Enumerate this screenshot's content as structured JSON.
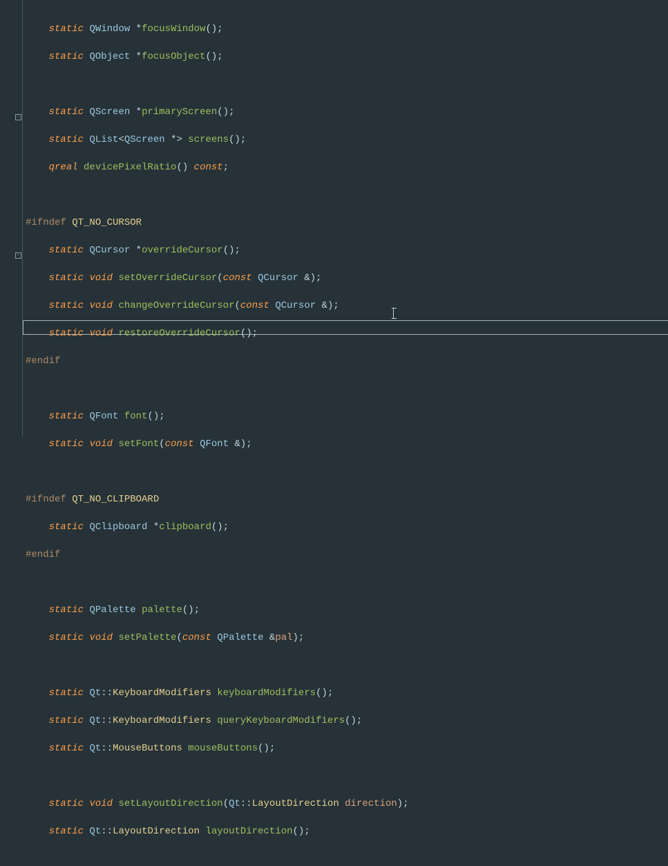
{
  "preprocessor": {
    "ifndef": "#ifndef",
    "endif": "#endif",
    "macro_cursor": "QT_NO_CURSOR",
    "macro_clipboard": "QT_NO_CLIPBOARD"
  },
  "kw": {
    "static": "static",
    "void": "void",
    "const": "const",
    "qreal": "qreal"
  },
  "types": {
    "QWindow": "QWindow",
    "QObject": "QObject",
    "QScreen": "QScreen",
    "QList_open": "QList",
    "QCursor": "QCursor",
    "QFont": "QFont",
    "QClipboard": "QClipboard",
    "QPalette": "QPalette",
    "Qt": "Qt",
    "KeyboardModifiers": "KeyboardModifiers",
    "MouseButtons": "MouseButtons",
    "LayoutDirection": "LayoutDirection"
  },
  "funcs": {
    "focusWindow": "focusWindow",
    "focusObject": "focusObject",
    "primaryScreen": "primaryScreen",
    "screens": "screens",
    "devicePixelRatio": "devicePixelRatio",
    "overrideCursor": "overrideCursor",
    "setOverrideCursor": "setOverrideCursor",
    "changeOverrideCursor": "changeOverrideCursor",
    "restoreOverrideCursor": "restoreOverrideCursor",
    "font": "font",
    "setFont": "setFont",
    "clipboard": "clipboard",
    "palette": "palette",
    "setPalette": "setPalette",
    "keyboardModifiers": "keyboardModifiers",
    "queryKeyboardModifiers": "queryKeyboardModifiers",
    "mouseButtons": "mouseButtons",
    "setLayoutDirection": "setLayoutDirection",
    "layoutDirection": "layoutDirection"
  },
  "params": {
    "pal": "pal",
    "direction": "direction"
  },
  "sym": {
    "star": "*",
    "lp": "(",
    "rp": ")",
    "semi": ";",
    "amp": "&",
    "lt": "<",
    "gt": ">",
    "dcolon": "::",
    "sp4": "    ",
    "sp8": "        "
  }
}
